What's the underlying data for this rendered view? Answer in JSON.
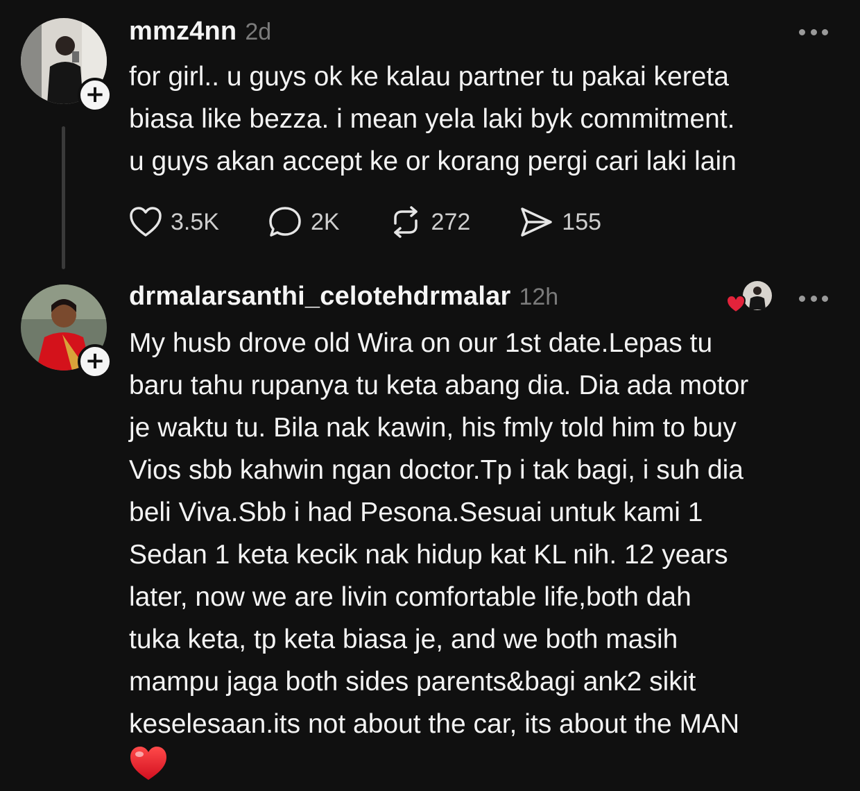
{
  "posts": [
    {
      "username": "mmz4nn",
      "time": "2d",
      "lines": [
        "for girl.. u guys ok ke kalau partner tu pakai kereta",
        "biasa like bezza. i mean yela laki byk commitment.",
        "u guys akan accept ke or korang pergi cari laki lain"
      ],
      "actions": {
        "likes": "3.5K",
        "comments": "2K",
        "reposts": "272",
        "shares": "155"
      }
    },
    {
      "username": "drmalarsanthi_celotehdrmalar",
      "time": "12h",
      "lines": [
        "My husb drove old Wira on our 1st date.Lepas tu",
        "baru tahu rupanya tu keta abang dia. Dia ada motor",
        "je waktu tu. Bila nak kawin, his fmly told him to buy",
        "Vios sbb kahwin ngan doctor.Tp i tak bagi, i suh dia",
        "beli Viva.Sbb i had Pesona.Sesuai untuk kami 1",
        "Sedan 1 keta kecik nak hidup kat KL nih. 12 years",
        "later, now we are livin comfortable life,both dah",
        "tuka keta, tp keta biasa je, and we both masih",
        "mampu jaga both sides parents&bagi ank2 sikit",
        "keselesaan.its not about the car, its about the MAN"
      ]
    }
  ],
  "icons": {
    "like": "heart-outline-icon",
    "comment": "speech-bubble-icon",
    "repost": "repost-arrows-icon",
    "share": "send-arrow-icon",
    "more": "more-horizontal-icon",
    "follow": "plus-icon",
    "author_liked": "red-heart-badge-icon",
    "emoji": "red-heart-emoji-icon"
  },
  "colors": {
    "background": "#101010",
    "text": "#f3f3f3",
    "muted": "#7b7b7b",
    "heart": "#e3233b"
  }
}
